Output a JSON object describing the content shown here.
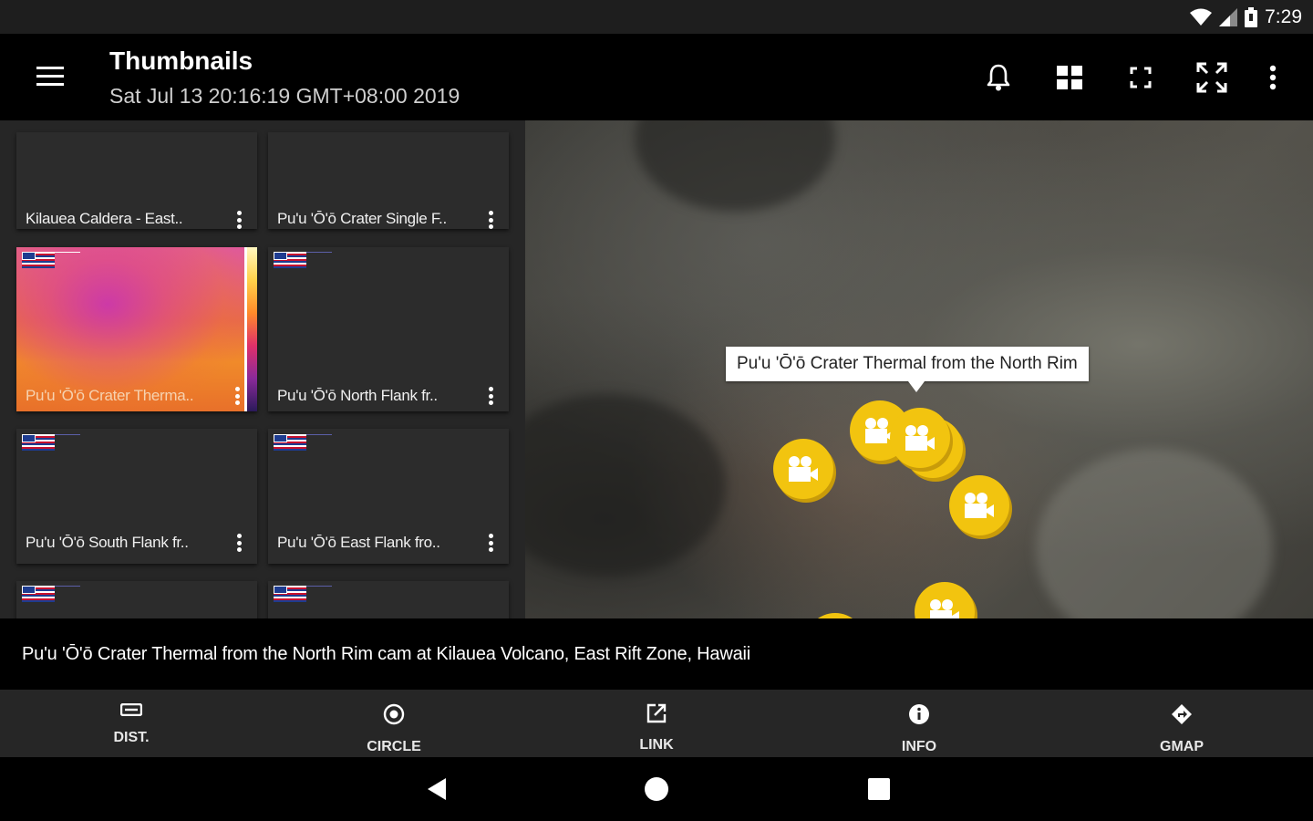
{
  "status_bar": {
    "time": "7:29"
  },
  "app_bar": {
    "title": "Thumbnails",
    "subtitle": "Sat Jul 13 20:16:19 GMT+08:00 2019",
    "actions": [
      "bell-icon",
      "grid-icon",
      "fullscreen-icon",
      "expand-icon",
      "more-vert-icon"
    ]
  },
  "thumbnails": [
    {
      "label": "Kilauea Caldera - East.."
    },
    {
      "label": "Pu'u 'Ō'ō Crater Single F.."
    },
    {
      "label": "Pu'u 'Ō'ō Crater Therma.."
    },
    {
      "label": "Pu'u 'Ō'ō North Flank fr.."
    },
    {
      "label": "Pu'u 'Ō'ō South Flank fr.."
    },
    {
      "label": "Pu'u 'Ō'ō East Flank fro.."
    }
  ],
  "map": {
    "tooltip": "Pu'u 'Ō'ō Crater Thermal from the North Rim",
    "marker_color": "#f2c40f"
  },
  "caption": "Pu'u 'Ō'ō Crater Thermal from the North Rim cam at Kilauea Volcano, East Rift Zone, Hawaii",
  "toolbar": [
    {
      "label": "DIST.",
      "icon": "ruler-icon"
    },
    {
      "label": "CIRCLE",
      "icon": "target-icon"
    },
    {
      "label": "LINK",
      "icon": "open-link-icon"
    },
    {
      "label": "INFO",
      "icon": "info-icon"
    },
    {
      "label": "GMAP",
      "icon": "directions-icon"
    }
  ]
}
